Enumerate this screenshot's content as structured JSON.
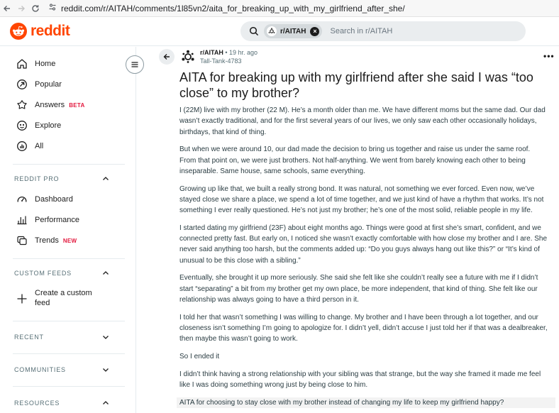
{
  "browser": {
    "url": "reddit.com/r/AITAH/comments/1l85vn2/aita_for_breaking_up_with_my_girlfriend_after_she/",
    "back_icon": "arrow-left-icon",
    "forward_icon": "arrow-right-icon",
    "reload_icon": "reload-icon"
  },
  "header": {
    "logo_text": "reddit",
    "search": {
      "chip_label": "r/AITAH",
      "placeholder": "Search in r/AITAH"
    }
  },
  "sidebar": {
    "primary": [
      {
        "label": "Home",
        "icon": "home-icon"
      },
      {
        "label": "Popular",
        "icon": "popular-icon"
      },
      {
        "label": "Answers",
        "icon": "answers-icon",
        "badge": "BETA"
      },
      {
        "label": "Explore",
        "icon": "explore-icon"
      },
      {
        "label": "All",
        "icon": "all-icon"
      }
    ],
    "reddit_pro": {
      "title": "REDDIT PRO",
      "items": [
        {
          "label": "Dashboard",
          "icon": "dashboard-icon"
        },
        {
          "label": "Performance",
          "icon": "performance-icon"
        },
        {
          "label": "Trends",
          "icon": "trends-icon",
          "badge": "NEW"
        }
      ]
    },
    "custom_feeds": {
      "title": "CUSTOM FEEDS",
      "create_line1": "Create a custom",
      "create_line2": "feed"
    },
    "recent": {
      "title": "RECENT"
    },
    "communities": {
      "title": "COMMUNITIES"
    },
    "resources": {
      "title": "RESOURCES"
    }
  },
  "post": {
    "subreddit": "r/AITAH",
    "separator": "•",
    "time": "19 hr. ago",
    "author": "Tall-Tank-4783",
    "title": "AITA for breaking up with my girlfriend after she said I was “too close” to my brother?",
    "paragraphs": [
      "I (22M) live with my brother (22 M). He’s a month older than me. We have different moms but the same dad. Our dad wasn’t exactly traditional, and for the first several years of our lives, we only saw each other occasionally holidays, birthdays, that kind of thing.",
      "But when we were around 10, our dad made the decision to bring us together and raise us under the same roof. From that point on, we were just brothers. Not half-anything. We went from barely knowing each other to being inseparable. Same house, same schools, same everything.",
      "Growing up like that, we built a really strong bond. It was natural, not something we ever forced. Even now, we’ve stayed close we share a place, we spend a lot of time together, and we just kind of have a rhythm that works. It’s not something I ever really questioned. He’s not just my brother; he’s one of the most solid, reliable people in my life.",
      "I started dating my girlfriend (23F) about eight months ago. Things were good at first she’s smart, confident, and we connected pretty fast. But early on, I noticed she wasn’t exactly comfortable with how close my brother and I are. She never said anything too harsh, but the comments added up: “Do you guys always hang out like this?” or “It’s kind of unusual to be this close with a sibling.”",
      "Eventually, she brought it up more seriously. She said she felt like she couldn’t really see a future with me if I didn’t start “separating” a bit from my brother get my own place, be more independent, that kind of thing. She felt like our relationship was always going to have a third person in it.",
      "I told her that wasn’t something I was willing to change. My brother and I have been through a lot together, and our closeness isn’t something I’m going to apologize for. I didn’t yell, didn’t accuse I just told her if that was a dealbreaker, then maybe this wasn’t going to work.",
      "So I ended it",
      "I didn’t think having a strong relationship with your sibling was that strange, but the way she framed it made me feel like I was doing something wrong just by being close to him.",
      "AITA for choosing to stay close with my brother instead of changing my life to keep my girlfriend happy?"
    ]
  },
  "colors": {
    "brand": "#ff4500",
    "badge": "#e3193e",
    "muted": "#576f76"
  }
}
